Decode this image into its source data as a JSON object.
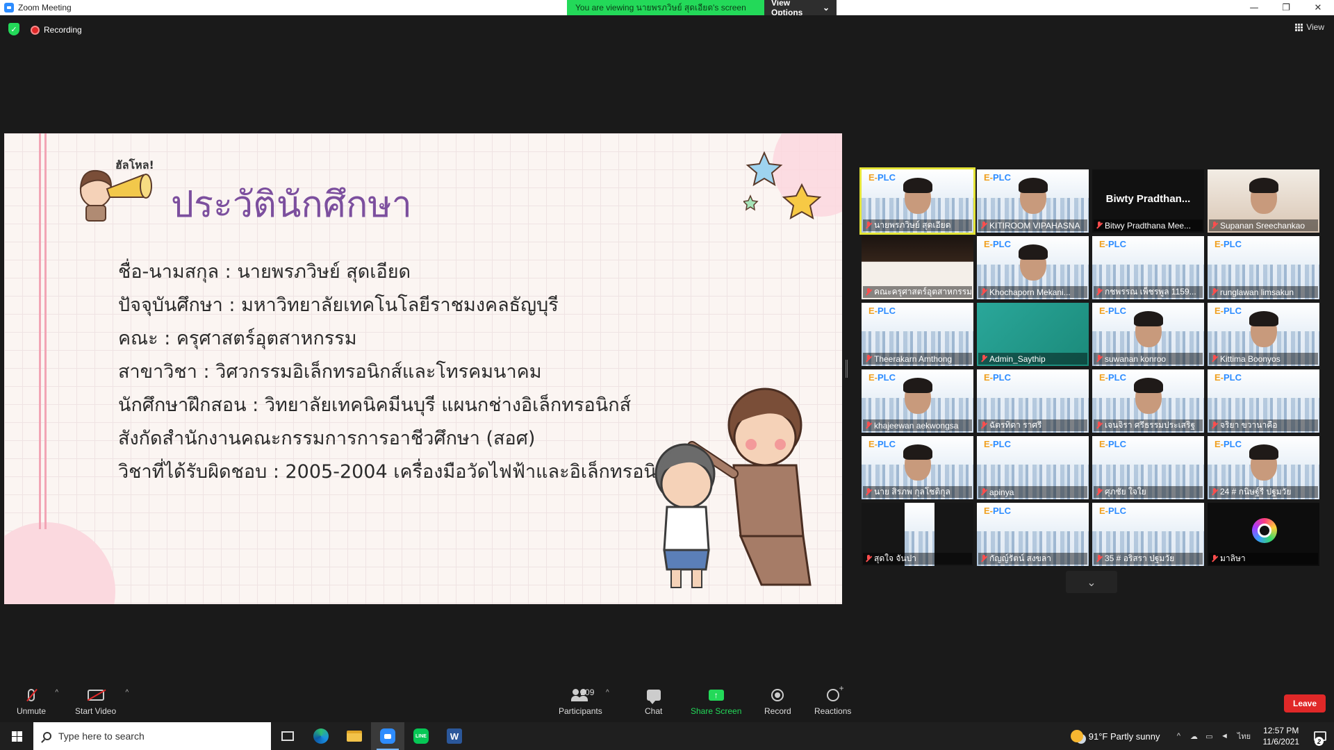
{
  "window": {
    "title": "Zoom Meeting",
    "viewing_banner": "You are viewing นายพรภวิษย์ สุดเอียด's screen",
    "view_options": "View Options",
    "chevron": "⌄",
    "minimize": "—",
    "restore": "❐",
    "close": "✕"
  },
  "status": {
    "recording": "Recording",
    "view": "View"
  },
  "slide": {
    "hello": "ฮัลโหล!",
    "heading": "ประวัตินักศึกษา",
    "lines": [
      "ชื่อ-นามสกุล : นายพรภวิษย์ สุดเอียด",
      "ปัจจุบันศึกษา : มหาวิทยาลัยเทคโนโลยีราชมงคลธัญบุรี",
      "คณะ : ครุศาสตร์อุตสาหกรรม",
      "สาขาวิชา : วิศวกรรมอิเล็กทรอนิกส์และโทรคมนาคม",
      "นักศึกษาฝึกสอน : วิทยาลัยเทคนิคมีนบุรี แผนกช่างอิเล็กทรอนิกส์",
      "สังกัดสำนักงานคณะกรรมการการอาชีวศึกษา (สอศ)",
      "วิชาที่ได้รับผิดชอบ : 2005-2004 เครื่องมือวัดไฟฟ้าและอิเล็กทรอนิกส์"
    ]
  },
  "gallery": {
    "logo_prefix": "E-",
    "logo_main": "PLC",
    "participants": [
      {
        "name": "นายพรภวิษย์ สุดเอียด",
        "kind": "face",
        "active": true
      },
      {
        "name": "KITIROOM VIPAHASNA",
        "kind": "face"
      },
      {
        "name": "Bitwy Pradthana Mee...",
        "kind": "black",
        "big": "Biwty Pradthan..."
      },
      {
        "name": "Supanan Sreechankao",
        "kind": "photo"
      },
      {
        "name": "คณะครุศาสตร์อุตสาหกรรม ม...",
        "kind": "doc"
      },
      {
        "name": "Khochaporn Mekani...",
        "kind": "face"
      },
      {
        "name": "กชพรรณ เพ็ชรพูล 1159...",
        "kind": "plain"
      },
      {
        "name": "runglawan limsakun",
        "kind": "plain"
      },
      {
        "name": "Theerakarn Amthong",
        "kind": "plain"
      },
      {
        "name": "Admin_Saythip",
        "kind": "teal"
      },
      {
        "name": "suwanan konroo",
        "kind": "face"
      },
      {
        "name": "Kittima Boonyos",
        "kind": "face"
      },
      {
        "name": "khajeewan aekwongsa",
        "kind": "face"
      },
      {
        "name": "ฉัตรทิดา ราศรี",
        "kind": "plain"
      },
      {
        "name": "เจนจิรา ศรีธรรมประเสริฐ",
        "kind": "face"
      },
      {
        "name": "จริยา ขวานาคือ",
        "kind": "plain"
      },
      {
        "name": "นาย สิรภพ กุลโชติกุล",
        "kind": "face"
      },
      {
        "name": "apinya",
        "kind": "plain"
      },
      {
        "name": "ศุภชัย ใจใย",
        "kind": "plain"
      },
      {
        "name": "24 # กนิษฐ์รี ปฐมวัย",
        "kind": "face"
      },
      {
        "name": "สุดใจ จันปา",
        "kind": "narrow"
      },
      {
        "name": "กัญญ์รัตน์ สงขลา",
        "kind": "plain"
      },
      {
        "name": "35 # อริสรา ปฐมวัย",
        "kind": "plain"
      },
      {
        "name": "มาลิษา",
        "kind": "cam"
      }
    ]
  },
  "controls": {
    "unmute": "Unmute",
    "start_video": "Start Video",
    "participants": "Participants",
    "participant_count": "209",
    "chat": "Chat",
    "share_screen": "Share Screen",
    "record": "Record",
    "reactions": "Reactions",
    "leave": "Leave",
    "caret": "^",
    "share_arrow": "↑"
  },
  "taskbar": {
    "search_placeholder": "Type here to search",
    "line_label": "LINE",
    "word_label": "W",
    "weather": "91°F  Partly sunny",
    "language": "ไทย",
    "time": "12:57 PM",
    "date": "11/6/2021",
    "notifications": "2",
    "tray_up": "^"
  },
  "colors": {
    "zoom_blue": "#2d8cff",
    "banner_green": "#23d959",
    "leave_red": "#e02828",
    "heading_purple": "#7c4f9e"
  }
}
